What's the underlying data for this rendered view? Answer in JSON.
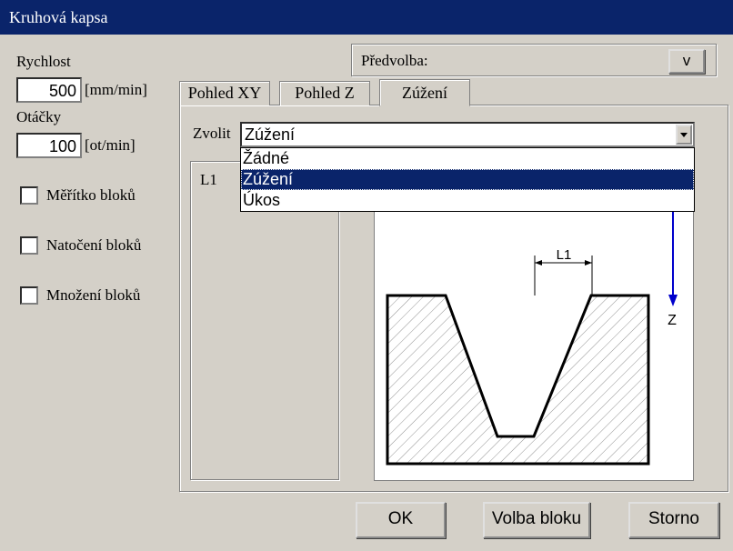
{
  "window": {
    "title": "Kruhová kapsa"
  },
  "left": {
    "speed_label": "Rychlost",
    "speed_value": "500",
    "speed_unit": "[mm/min]",
    "rpm_label": "Otáčky",
    "rpm_value": "100",
    "rpm_unit": "[ot/min]",
    "checkboxes": [
      {
        "label": "Měřítko bloků",
        "checked": false
      },
      {
        "label": "Natočení bloků",
        "checked": false
      },
      {
        "label": "Množení bloků",
        "checked": false
      }
    ]
  },
  "preset": {
    "label": "Předvolba:",
    "button": "v"
  },
  "tabs": [
    {
      "label": "Pohled XY"
    },
    {
      "label": "Pohled Z"
    },
    {
      "label": "Zúžení"
    }
  ],
  "active_tab": 2,
  "panel": {
    "select_label": "Zvolit",
    "select_value": "Zúžení",
    "options": [
      "Žádné",
      "Zúžení",
      "Úkos"
    ],
    "selected_index": 1,
    "param_label": "L1"
  },
  "diagram": {
    "dimension_label": "L1",
    "axis_label": "Z",
    "axis_color": "#0000cc"
  },
  "buttons": {
    "ok": "OK",
    "block_select": "Volba bloku",
    "cancel": "Storno"
  }
}
